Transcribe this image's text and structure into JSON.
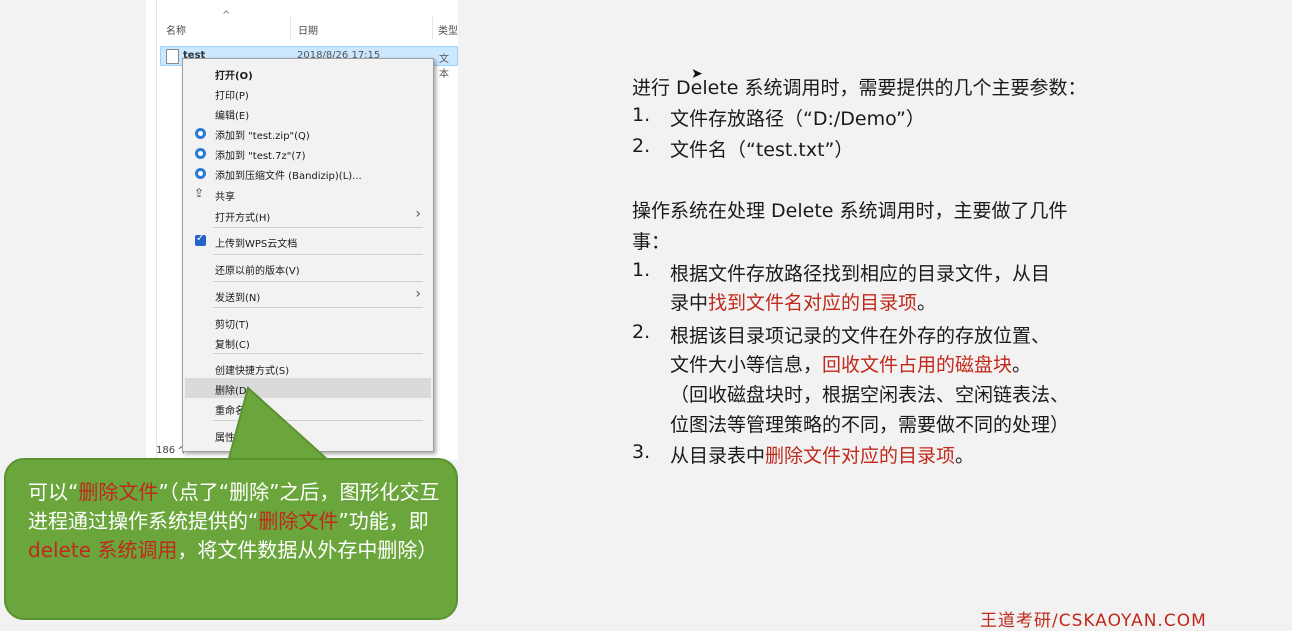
{
  "explorer": {
    "columns": [
      "名称",
      "日期",
      "类型"
    ],
    "file": {
      "name": "test",
      "date": "2018/8/26 17:15",
      "type": "文本"
    },
    "status": "186 个"
  },
  "context_menu": {
    "items": [
      {
        "label": "打开(O)",
        "bold": true
      },
      {
        "label": "打印(P)"
      },
      {
        "label": "编辑(E)"
      },
      {
        "label": "添加到 \"test.zip\"(Q)",
        "icon": "bandizip-icon"
      },
      {
        "label": "添加到 \"test.7z\"(7)",
        "icon": "bandizip-icon"
      },
      {
        "label": "添加到压缩文件 (Bandizip)(L)...",
        "icon": "bandizip-icon"
      },
      {
        "label": "共享",
        "icon": "share-icon"
      },
      {
        "label": "打开方式(H)",
        "submenu": true
      },
      {
        "label": "上传到WPS云文档",
        "icon": "wps-cloud-icon"
      },
      {
        "label": "还原以前的版本(V)"
      },
      {
        "label": "发送到(N)",
        "submenu": true
      },
      {
        "label": "剪切(T)"
      },
      {
        "label": "复制(C)"
      },
      {
        "label": "创建快捷方式(S)"
      },
      {
        "label": "删除(D)",
        "highlighted": true
      },
      {
        "label": "重命名(M)"
      },
      {
        "label": "属性(R)"
      }
    ]
  },
  "callout": {
    "t1": "可以“",
    "t2": "删除文件",
    "t3": "”（点了“删除”之后，图形化交互进程通过操作系统提供的“",
    "t4": "删除文件",
    "t5": "”功能，即 ",
    "t6": "delete 系统调用",
    "t7": "，将文件数据从外存中删除）"
  },
  "right_panel": {
    "intro": "进行 Delete 系统调用时，需要提供的几个主要参数：",
    "params": [
      {
        "num": "1.",
        "text": "文件存放路径（“D:/Demo”）"
      },
      {
        "num": "2.",
        "text": "文件名（“test.txt”）"
      }
    ],
    "ops_intro_1": "操作系统在处理 Delete 系统调用时，主要做了几件",
    "ops_intro_2": "事：",
    "step1": {
      "num": "1.",
      "a": "根据文件存放路径找到相应的目录文件，从目",
      "b": "录中",
      "b_red": "找到文件名对应的目录项",
      "b_end": "。"
    },
    "step2": {
      "num": "2.",
      "a": "根据该目录项记录的文件在外存的存放位置、",
      "b": "文件大小等信息，",
      "b_red": "回收文件占用的磁盘块",
      "b_end": "。",
      "c": "（回收磁盘块时，根据空闲表法、空闲链表法、",
      "d": "位图法等管理策略的不同，需要做不同的处理）"
    },
    "step3": {
      "num": "3.",
      "a": "从目录表中",
      "a_red": "删除文件对应的目录项",
      "a_end": "。"
    }
  },
  "watermark": "王道考研/CSKAOYAN.COM",
  "colors": {
    "accent_red": "#c0291b",
    "callout_green": "#6aa63c",
    "menu_bg": "#f2f2f2"
  }
}
